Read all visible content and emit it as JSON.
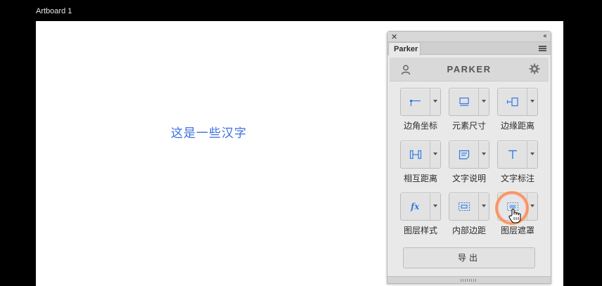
{
  "artboard": {
    "label": "Artboard 1"
  },
  "canvas": {
    "sample_text": "这是一些汉字"
  },
  "panel": {
    "tab_label": "Parker",
    "header_title": "PARKER",
    "tools": [
      {
        "label": "边角坐标",
        "icon": "corner-coordinate-icon"
      },
      {
        "label": "元素尺寸",
        "icon": "element-size-icon"
      },
      {
        "label": "边缘距离",
        "icon": "edge-distance-icon"
      },
      {
        "label": "相互距离",
        "icon": "mutual-distance-icon"
      },
      {
        "label": "文字说明",
        "icon": "text-note-icon"
      },
      {
        "label": "文字标注",
        "icon": "text-annotate-icon"
      },
      {
        "label": "图层样式",
        "icon": "layer-style-icon"
      },
      {
        "label": "内部边距",
        "icon": "inner-padding-icon"
      },
      {
        "label": "图层遮罩",
        "icon": "layer-mask-icon"
      }
    ],
    "export_label": "导出",
    "icon_color": "#2e7ae6"
  }
}
